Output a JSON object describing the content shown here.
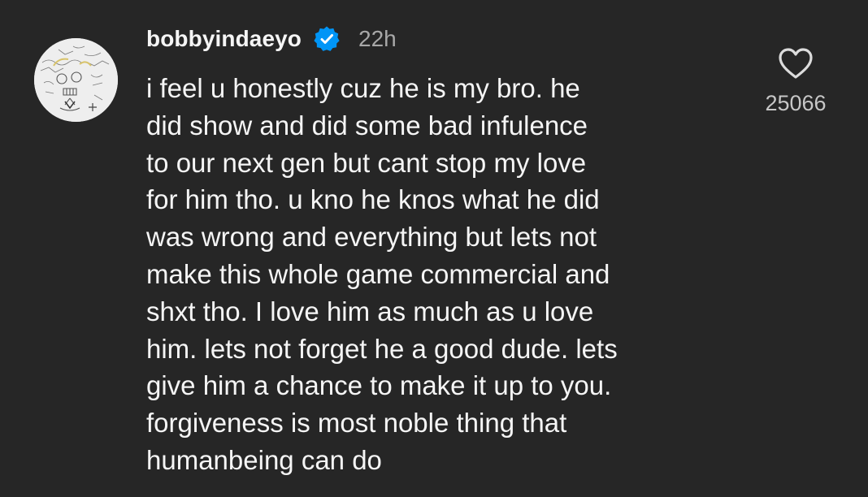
{
  "comment": {
    "username": "bobbyindaeyo",
    "verified_icon": "verified-badge-icon",
    "timestamp": "22h",
    "body_lines": [
      "i feel u honestly cuz he is my bro. he",
      "did show and did some bad infulence",
      "to our next gen but cant stop my love",
      "for him tho. u kno he knos what he did",
      "was wrong and everything but lets not",
      "make this whole game commercial and",
      "shxt tho. I love him as much as u love",
      "him. lets not forget he a good dude. lets",
      "give him a chance to make it up to you.",
      "forgiveness is most noble thing that",
      "humanbeing can do"
    ],
    "like_icon": "heart-outline-icon",
    "like_count": "25066"
  },
  "colors": {
    "background": "#262626",
    "text_primary": "#f5f5f5",
    "text_secondary": "#a8a8a8",
    "verified_blue": "#0095f6"
  }
}
